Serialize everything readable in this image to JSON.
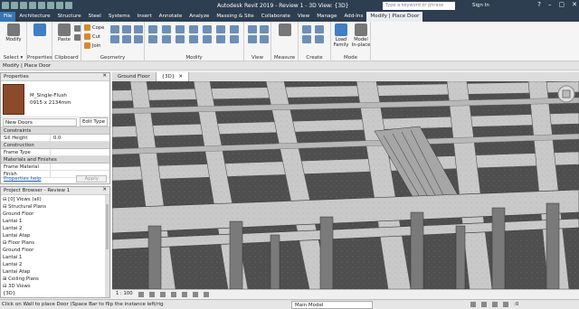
{
  "titlebar": {
    "title": "Autodesk Revit 2019 - Review 1 - 3D View: {3D}",
    "search_placeholder": "Type a keyword or phrase",
    "user": "Sign In",
    "help": "?",
    "min": "–",
    "max": "▢",
    "close": "✕"
  },
  "menu": [
    "File",
    "Architecture",
    "Structure",
    "Steel",
    "Systems",
    "Insert",
    "Annotate",
    "Analyze",
    "Massing & Site",
    "Collaborate",
    "View",
    "Manage",
    "Add-Ins",
    "Modify | Place Door"
  ],
  "ribbon": {
    "select": {
      "label": "Select ▾",
      "modify": "Modify"
    },
    "properties": {
      "label": "Properties",
      "btn": "Properties"
    },
    "clipboard": {
      "label": "Clipboard",
      "paste": "Paste"
    },
    "geometry": {
      "label": "Geometry",
      "cope": "Cope",
      "cut": "Cut",
      "join": "Join"
    },
    "modify": {
      "label": "Modify"
    },
    "view": {
      "label": "View"
    },
    "measure": {
      "label": "Measure"
    },
    "create": {
      "label": "Create"
    },
    "mode": {
      "label": "Mode",
      "load": "Load Family",
      "inplace": "Model In-place"
    }
  },
  "context": "Modify | Place Door",
  "properties": {
    "title": "Properties",
    "close": "✕",
    "type_name": "M_Single-Flush",
    "type_size": "0915 x 2134mm",
    "instance_selector": "New Doors",
    "edit_type": "Edit Type",
    "sections": [
      {
        "name": "Constraints",
        "rows": [
          {
            "k": "Sill Height",
            "v": "0.0"
          }
        ]
      },
      {
        "name": "Construction",
        "rows": [
          {
            "k": "Frame Type",
            "v": ""
          }
        ]
      },
      {
        "name": "Materials and Finishes",
        "rows": [
          {
            "k": "Frame Material",
            "v": ""
          },
          {
            "k": "Finish",
            "v": ""
          }
        ]
      }
    ],
    "help_link": "Properties help",
    "apply": "Apply"
  },
  "browser": {
    "title": "Project Browser - Review 1",
    "close": "✕",
    "items": [
      "⊟ [0] Views (all)",
      "   ⊟ Structural Plans",
      "         Ground Floor",
      "         Lantai 1",
      "         Lantai 2",
      "         Lantai Atap",
      "   ⊟ Floor Plans",
      "         Ground Floor",
      "         Lantai 1",
      "         Lantai 2",
      "         Lantai Atap",
      "   ⊞ Ceiling Plans",
      "   ⊟ 3D Views",
      "         {3D}"
    ]
  },
  "viewtabs": [
    {
      "label": "Ground Floor",
      "close": "",
      "active": false
    },
    {
      "label": "{3D}",
      "close": "✕",
      "active": true
    }
  ],
  "viewctrl": {
    "scale": "1 : 100"
  },
  "status": {
    "message": "Click on Wall to place Door (Space Bar to flip the instance left/rig",
    "model": "Main Model",
    "filter": ":0"
  },
  "colors": {
    "titlebar": "#2d3e50",
    "file_tab": "#3576b5",
    "viewport_bg": "#8f8f8f",
    "concrete": "#c4c4c4",
    "slab_dark": "#4a4a4a"
  }
}
